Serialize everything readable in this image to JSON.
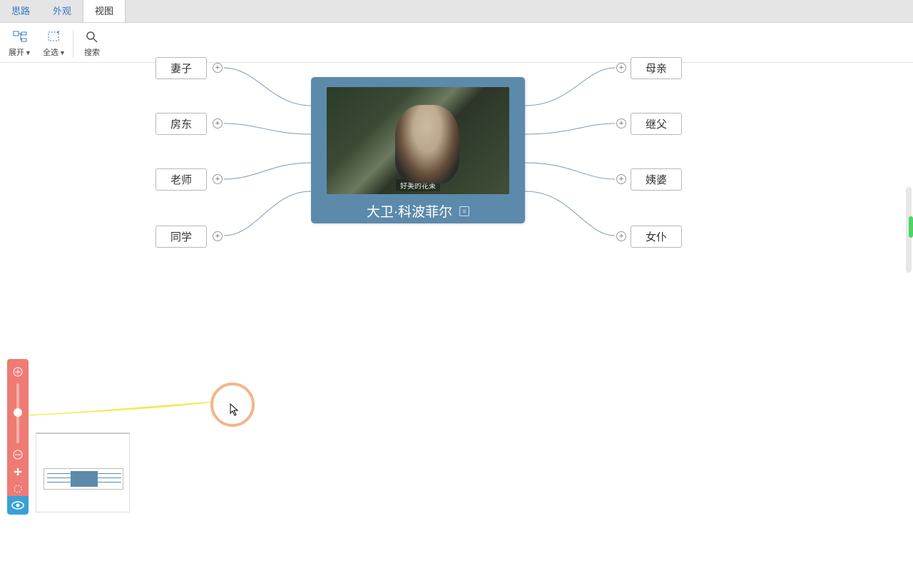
{
  "ribbon": {
    "tabs": [
      "思路",
      "外观",
      "视图"
    ],
    "activeIndex": 2
  },
  "toolbar": {
    "expand": "展开",
    "selectAll": "全选",
    "search": "搜索"
  },
  "mindmap": {
    "center": {
      "title": "大卫·科波菲尔",
      "image_caption": "好美的花束"
    },
    "left": [
      {
        "label": "妻子"
      },
      {
        "label": "房东"
      },
      {
        "label": "老师"
      },
      {
        "label": "同学"
      }
    ],
    "right": [
      {
        "label": "母亲"
      },
      {
        "label": "继父"
      },
      {
        "label": "姨婆"
      },
      {
        "label": "女仆"
      }
    ]
  }
}
